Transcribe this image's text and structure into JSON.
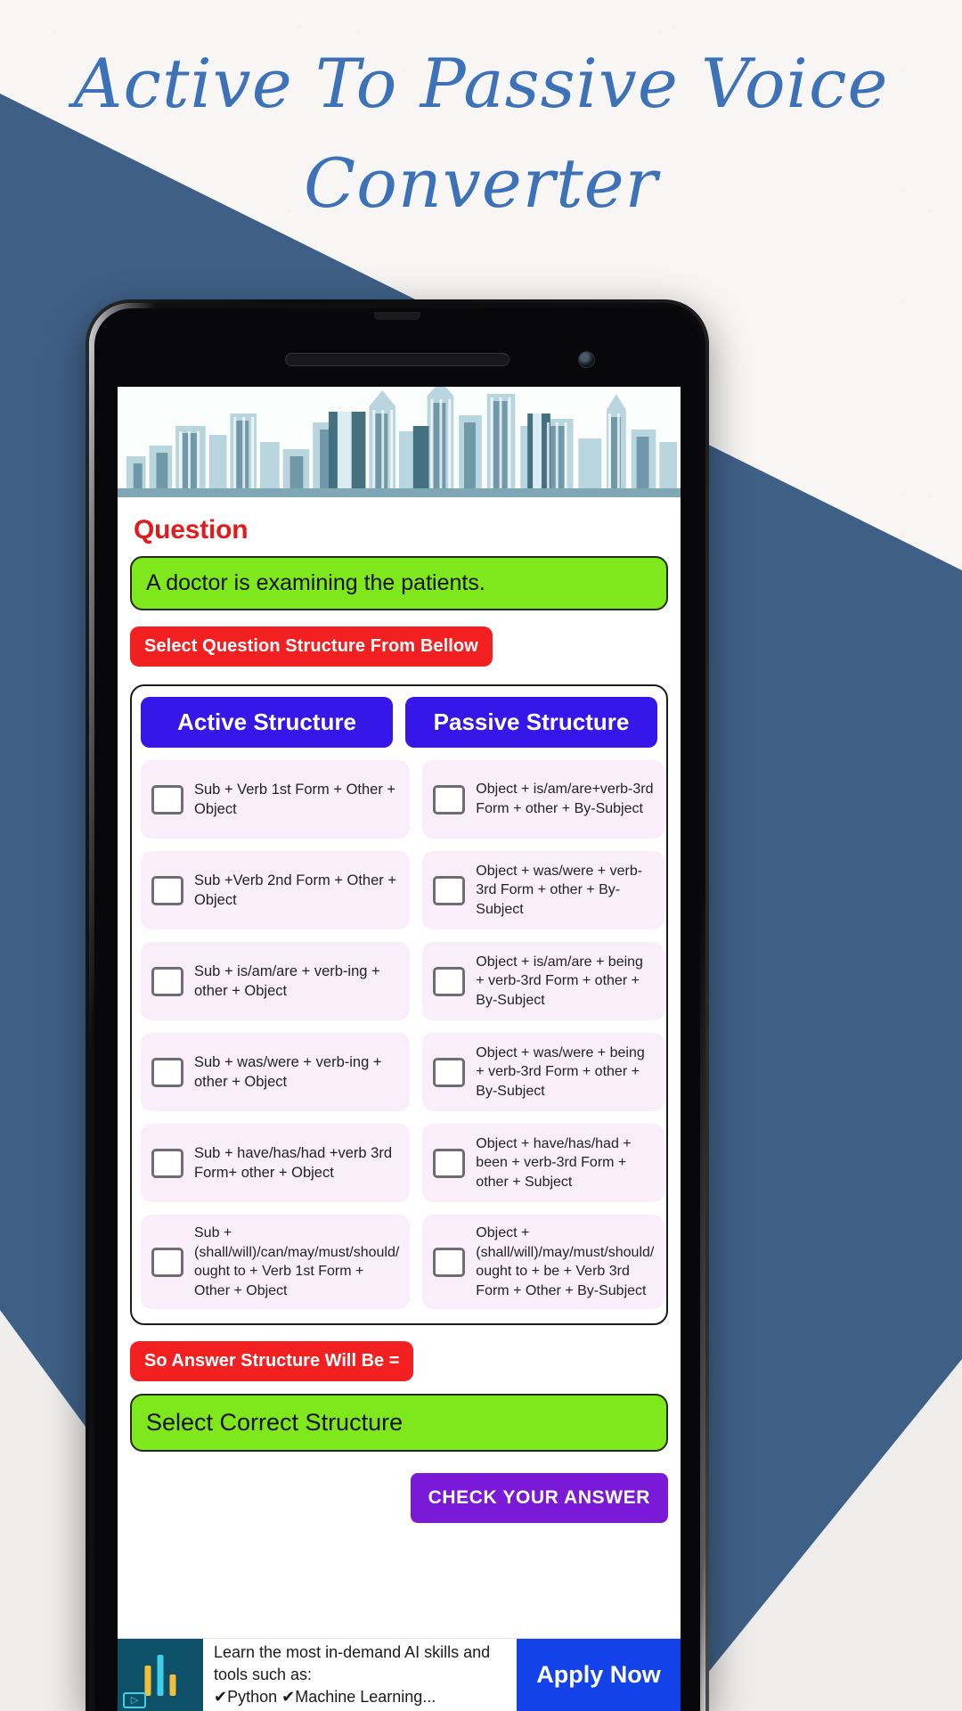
{
  "poster": {
    "title_line1": "Active To Passive Voice",
    "title_line2": "Converter",
    "title_color": "#3d72b8",
    "bg_accent_color": "#3f6086"
  },
  "app": {
    "header_image": "city-skyline-illustration",
    "question_heading": "Question",
    "question_heading_color": "#e01b1b",
    "question_text": "A doctor is examining the patients.",
    "question_box_color": "#7ee81c",
    "select_structure_button": "Select Question Structure From Bellow",
    "select_structure_button_color": "#f22020",
    "structure_table": {
      "active_header": "Active Structure",
      "passive_header": "Passive Structure",
      "header_color": "#3616e8",
      "active_options": [
        "Sub + Verb 1st Form + Other + Object",
        "Sub +Verb 2nd Form + Other + Object",
        "Sub + is/am/are + verb-ing + other + Object",
        "Sub + was/were + verb-ing + other + Object",
        "Sub + have/has/had +verb 3rd Form+ other + Object",
        "Sub + (shall/will)/can/may/must/should/ ought to + Verb 1st Form + Other + Object"
      ],
      "passive_options": [
        "Object + is/am/are+verb-3rd Form + other + By-Subject",
        "Object + was/were + verb-3rd Form + other + By-Subject",
        "Object + is/am/are + being + verb-3rd Form + other + By-Subject",
        "Object + was/were + being + verb-3rd Form + other + By-Subject",
        "Object + have/has/had + been + verb-3rd Form + other + Subject",
        "Object + (shall/will)/may/must/should/ ought to + be + Verb 3rd Form + Other + By-Subject"
      ],
      "checkbox_state": "unchecked"
    },
    "answer_structure_button": "So Answer Structure Will Be =",
    "answer_structure_button_color": "#f22020",
    "answer_box_text": "Select Correct Structure",
    "answer_box_color": "#7ee81c",
    "check_answer_button": "CHECK YOUR ANSWER",
    "check_answer_button_color": "#7b19d8"
  },
  "ad": {
    "line1": "Learn the most in-demand AI skills and tools such as:",
    "line2": "✔Python ✔Machine Learning...",
    "cta": "Apply Now",
    "cta_color": "#1242e8",
    "thumb_color": "#0d5068",
    "badge_label": "▷"
  }
}
